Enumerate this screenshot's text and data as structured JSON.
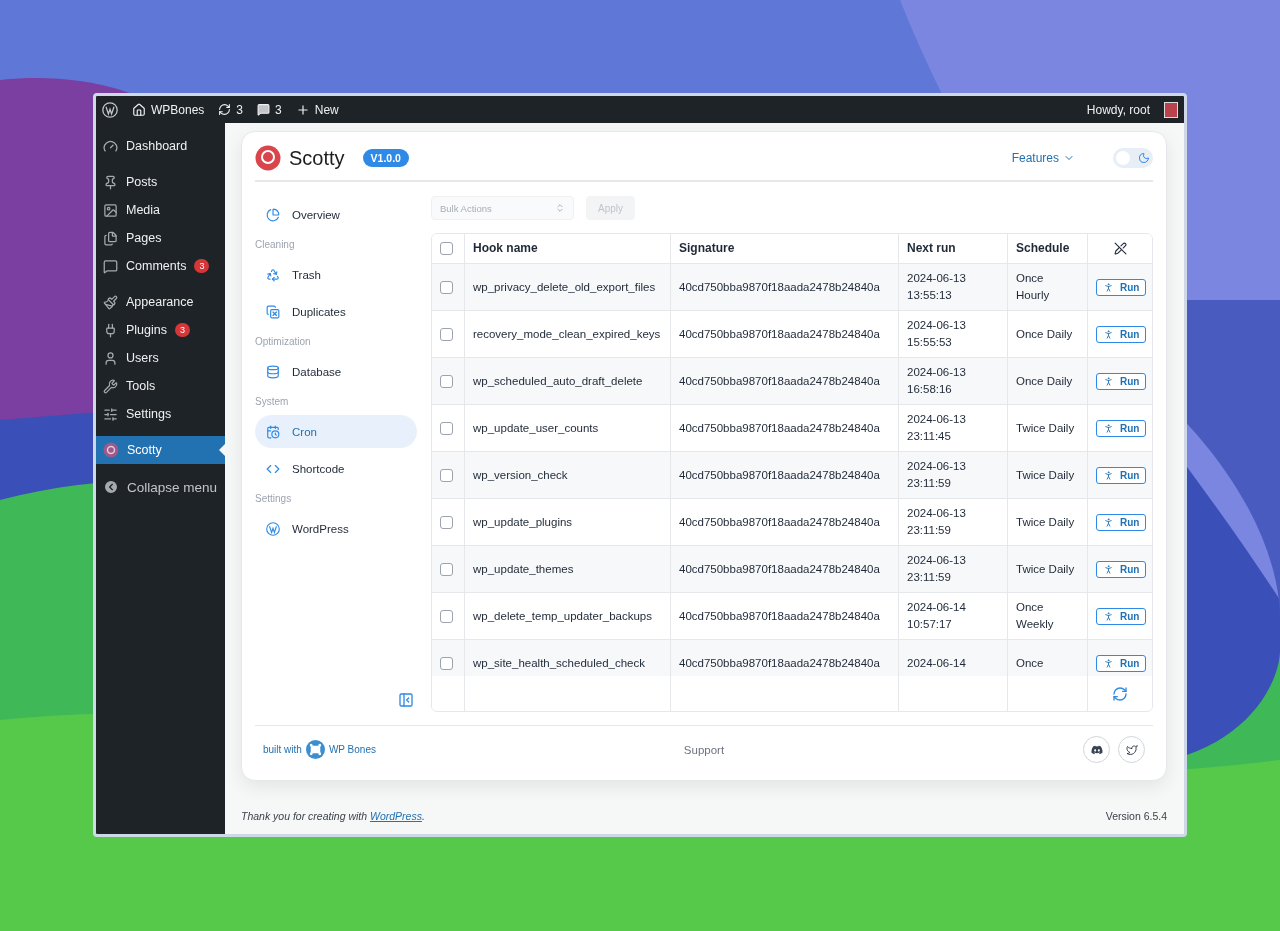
{
  "admin_bar": {
    "site": "WPBones",
    "updates": "3",
    "comments": "3",
    "new": "New",
    "greeting": "Howdy, root"
  },
  "sidebar": {
    "groups": [
      [
        {
          "label": "Dashboard",
          "selected": false
        }
      ],
      [
        {
          "label": "Posts",
          "selected": false
        },
        {
          "label": "Media",
          "selected": false
        },
        {
          "label": "Pages",
          "selected": false
        },
        {
          "label": "Comments",
          "badge": "3",
          "selected": false
        }
      ],
      [
        {
          "label": "Appearance",
          "selected": false
        },
        {
          "label": "Plugins",
          "badge": "3",
          "selected": false
        },
        {
          "label": "Users",
          "selected": false
        },
        {
          "label": "Tools",
          "selected": false
        },
        {
          "label": "Settings",
          "selected": false
        }
      ],
      [
        {
          "label": "Scotty",
          "selected": true
        }
      ]
    ],
    "collapse": "Collapse menu"
  },
  "plugin": {
    "name": "Scotty",
    "version": "V1.0.0",
    "features": "Features",
    "dark_mode": false
  },
  "nav": [
    {
      "items": [
        {
          "label": "Overview",
          "selected": false
        }
      ]
    },
    {
      "title": "Cleaning",
      "items": [
        {
          "label": "Trash",
          "selected": false
        },
        {
          "label": "Duplicates",
          "selected": false
        }
      ]
    },
    {
      "title": "Optimization",
      "items": [
        {
          "label": "Database",
          "selected": false
        }
      ]
    },
    {
      "title": "System",
      "items": [
        {
          "label": "Cron",
          "selected": true
        },
        {
          "label": "Shortcode",
          "selected": false
        }
      ]
    },
    {
      "title": "Settings",
      "items": [
        {
          "label": "WordPress",
          "selected": false
        }
      ]
    }
  ],
  "bulk": {
    "placeholder": "Bulk Actions",
    "apply": "Apply",
    "disabled": true
  },
  "table": {
    "all_checked": false,
    "columns": [
      "Hook name",
      "Signature",
      "Next run",
      "Schedule"
    ],
    "rows": [
      {
        "checked": false,
        "hook": "wp_privacy_delete_old_export_files",
        "signature": "40cd750bba9870f18aada2478b24840a",
        "date": "2024-06-13",
        "time": "13:55:13",
        "schedule": "Once Hourly",
        "action": "Run"
      },
      {
        "checked": false,
        "hook": "recovery_mode_clean_expired_keys",
        "signature": "40cd750bba9870f18aada2478b24840a",
        "date": "2024-06-13",
        "time": "15:55:53",
        "schedule": "Once Daily",
        "action": "Run"
      },
      {
        "checked": false,
        "hook": "wp_scheduled_auto_draft_delete",
        "signature": "40cd750bba9870f18aada2478b24840a",
        "date": "2024-06-13",
        "time": "16:58:16",
        "schedule": "Once Daily",
        "action": "Run"
      },
      {
        "checked": false,
        "hook": "wp_update_user_counts",
        "signature": "40cd750bba9870f18aada2478b24840a",
        "date": "2024-06-13",
        "time": "23:11:45",
        "schedule": "Twice Daily",
        "action": "Run"
      },
      {
        "checked": false,
        "hook": "wp_version_check",
        "signature": "40cd750bba9870f18aada2478b24840a",
        "date": "2024-06-13",
        "time": "23:11:59",
        "schedule": "Twice Daily",
        "action": "Run"
      },
      {
        "checked": false,
        "hook": "wp_update_plugins",
        "signature": "40cd750bba9870f18aada2478b24840a",
        "date": "2024-06-13",
        "time": "23:11:59",
        "schedule": "Twice Daily",
        "action": "Run"
      },
      {
        "checked": false,
        "hook": "wp_update_themes",
        "signature": "40cd750bba9870f18aada2478b24840a",
        "date": "2024-06-13",
        "time": "23:11:59",
        "schedule": "Twice Daily",
        "action": "Run"
      },
      {
        "checked": false,
        "hook": "wp_delete_temp_updater_backups",
        "signature": "40cd750bba9870f18aada2478b24840a",
        "date": "2024-06-14",
        "time": "10:57:17",
        "schedule": "Once Weekly",
        "action": "Run"
      },
      {
        "checked": false,
        "hook": "wp_site_health_scheduled_check",
        "signature": "40cd750bba9870f18aada2478b24840a",
        "date": "2024-06-14",
        "schedule": "Once",
        "action": "Run"
      }
    ]
  },
  "card_footer": {
    "built_with": "built with",
    "brand": "WP Bones",
    "support": "Support"
  },
  "wp_footer": {
    "before": "Thank you for creating with ",
    "link": "WordPress",
    "after": ".",
    "version": "Version 6.5.4"
  }
}
